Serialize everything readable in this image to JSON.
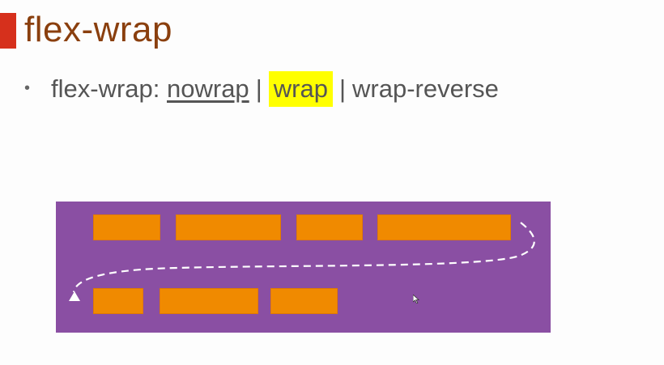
{
  "slide": {
    "title": "flex-wrap",
    "bullet": {
      "prefix": "flex-wrap: ",
      "options": [
        "nowrap",
        "wrap",
        "wrap-reverse"
      ],
      "separator": "|"
    }
  },
  "colors": {
    "title": "#8a3f0e",
    "accent_bar": "#d6301c",
    "highlight": "#ffff00",
    "container": "#8a4fa3",
    "item": "#f08a00",
    "path": "#ffffff"
  },
  "diagram": {
    "row1_item_count": 4,
    "row2_item_count": 3,
    "flow": "dashed arrow from end of first row wrapping to start of second row"
  }
}
